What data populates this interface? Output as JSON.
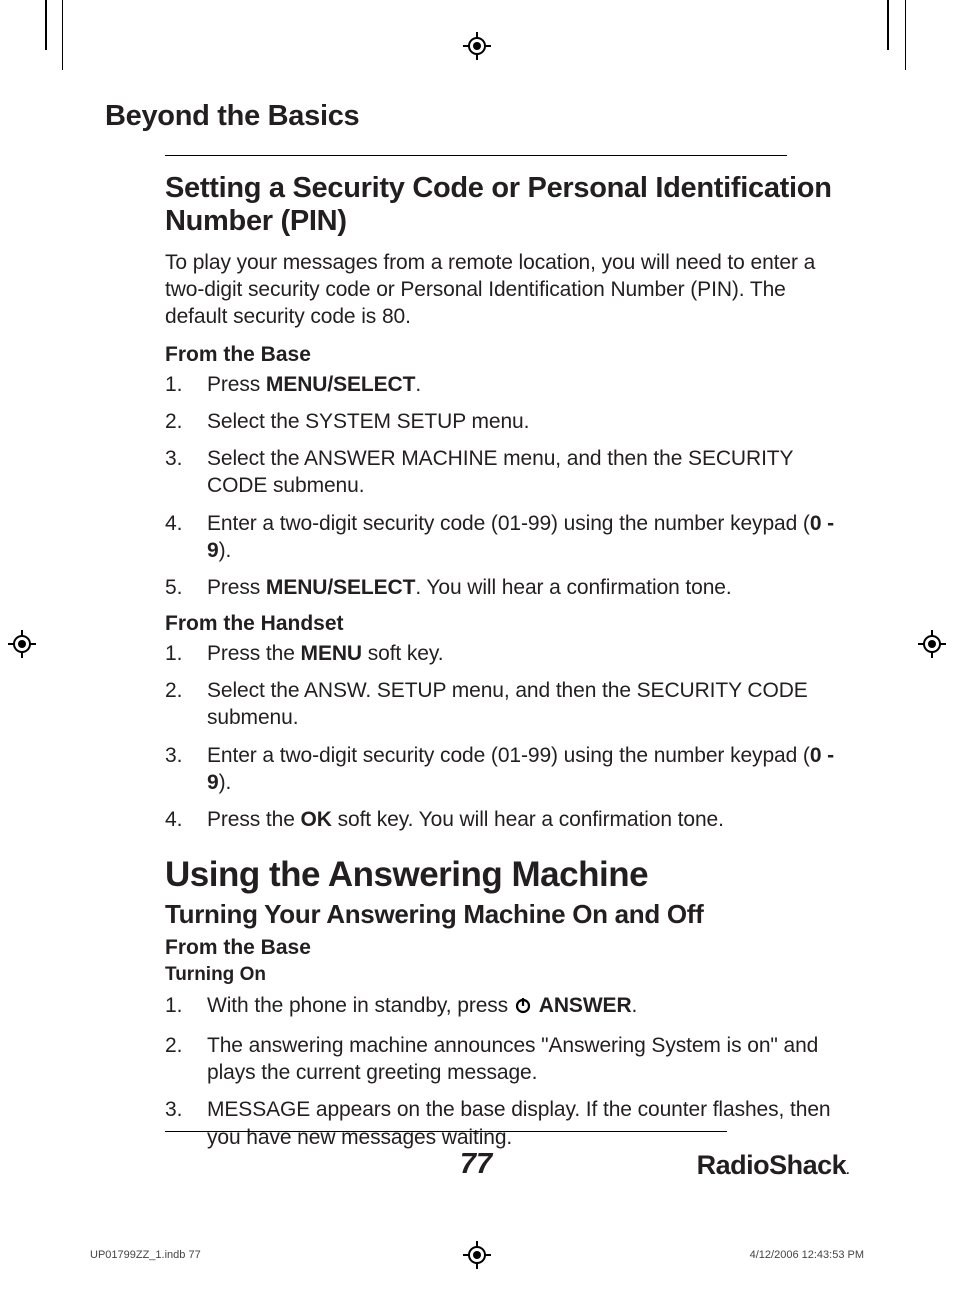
{
  "section_title": "Beyond the Basics",
  "h2_security": "Setting a Security Code or Personal Identification Number (PIN)",
  "intro_security": "To play your messages from a remote location, you will need to enter a two-digit security code or Personal Identification Number (PIN). The default security code is 80.",
  "from_base_label": "From the Base",
  "base_steps": [
    {
      "pre": "Press ",
      "bold": "MENU/SELECT",
      "post": "."
    },
    {
      "pre": "Select the SYSTEM SETUP menu.",
      "bold": "",
      "post": ""
    },
    {
      "pre": "Select the ANSWER MACHINE menu, and then the SECURITY CODE submenu.",
      "bold": "",
      "post": ""
    },
    {
      "pre": "Enter a two-digit security code (01-99) using the number keypad (",
      "bold": "0 - 9",
      "post": ")."
    },
    {
      "pre": "Press ",
      "bold": "MENU/SELECT",
      "post": ". You will hear a confirmation tone."
    }
  ],
  "from_handset_label": "From the Handset",
  "handset_steps": [
    {
      "pre": "Press the ",
      "bold": "MENU",
      "post": " soft key."
    },
    {
      "pre": "Select the ANSW. SETUP menu, and then the SECURITY CODE submenu.",
      "bold": "",
      "post": ""
    },
    {
      "pre": "Enter a two-digit security code (01-99) using the number keypad (",
      "bold": "0 - 9",
      "post": ")."
    },
    {
      "pre": "Press the ",
      "bold": "OK",
      "post": " soft key. You will hear a confirmation tone."
    }
  ],
  "h1_using": "Using the Answering Machine",
  "h2_turning": "Turning Your Answering Machine On and Off",
  "turning_on_label": "Turning On",
  "on_steps": [
    {
      "pre": "With the phone in standby, press ",
      "icon": true,
      "bold": " ANSWER",
      "post": "."
    },
    {
      "pre": "The answering machine announces \"Answering System is on\" and plays the current greeting message.",
      "bold": "",
      "post": ""
    },
    {
      "pre": "MESSAGE appears on the base display. If the counter flashes, then you have new messages waiting.",
      "bold": "",
      "post": ""
    }
  ],
  "page_num": "77",
  "brand": "RadioShack",
  "footer_file": "UP01799ZZ_1.indb   77",
  "footer_time": "4/12/2006   12:43:53 PM"
}
